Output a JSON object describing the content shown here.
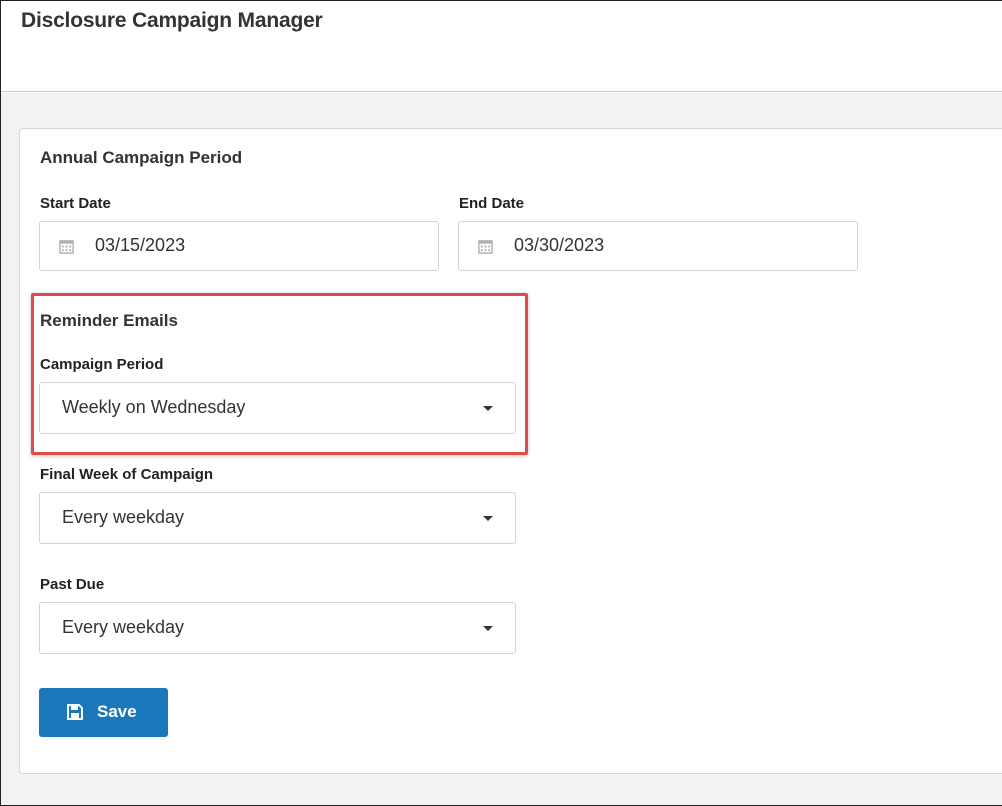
{
  "app": {
    "title": "Disclosure Campaign Manager"
  },
  "annual": {
    "title": "Annual Campaign Period",
    "start_label": "Start Date",
    "start_value": "03/15/2023",
    "end_label": "End Date",
    "end_value": "03/30/2023"
  },
  "reminders": {
    "title": "Reminder Emails",
    "campaign_period": {
      "label": "Campaign Period",
      "value": "Weekly on Wednesday"
    },
    "final_week": {
      "label": "Final Week of Campaign",
      "value": "Every weekday"
    },
    "past_due": {
      "label": "Past Due",
      "value": "Every weekday"
    }
  },
  "actions": {
    "save_label": "Save"
  },
  "icons": {
    "calendar": "calendar-icon",
    "caret": "caret-down-icon",
    "save": "floppy-disk-icon"
  },
  "colors": {
    "accent": "#1a78bb",
    "highlight": "#e04a4a",
    "background": "#f2f2f2"
  }
}
